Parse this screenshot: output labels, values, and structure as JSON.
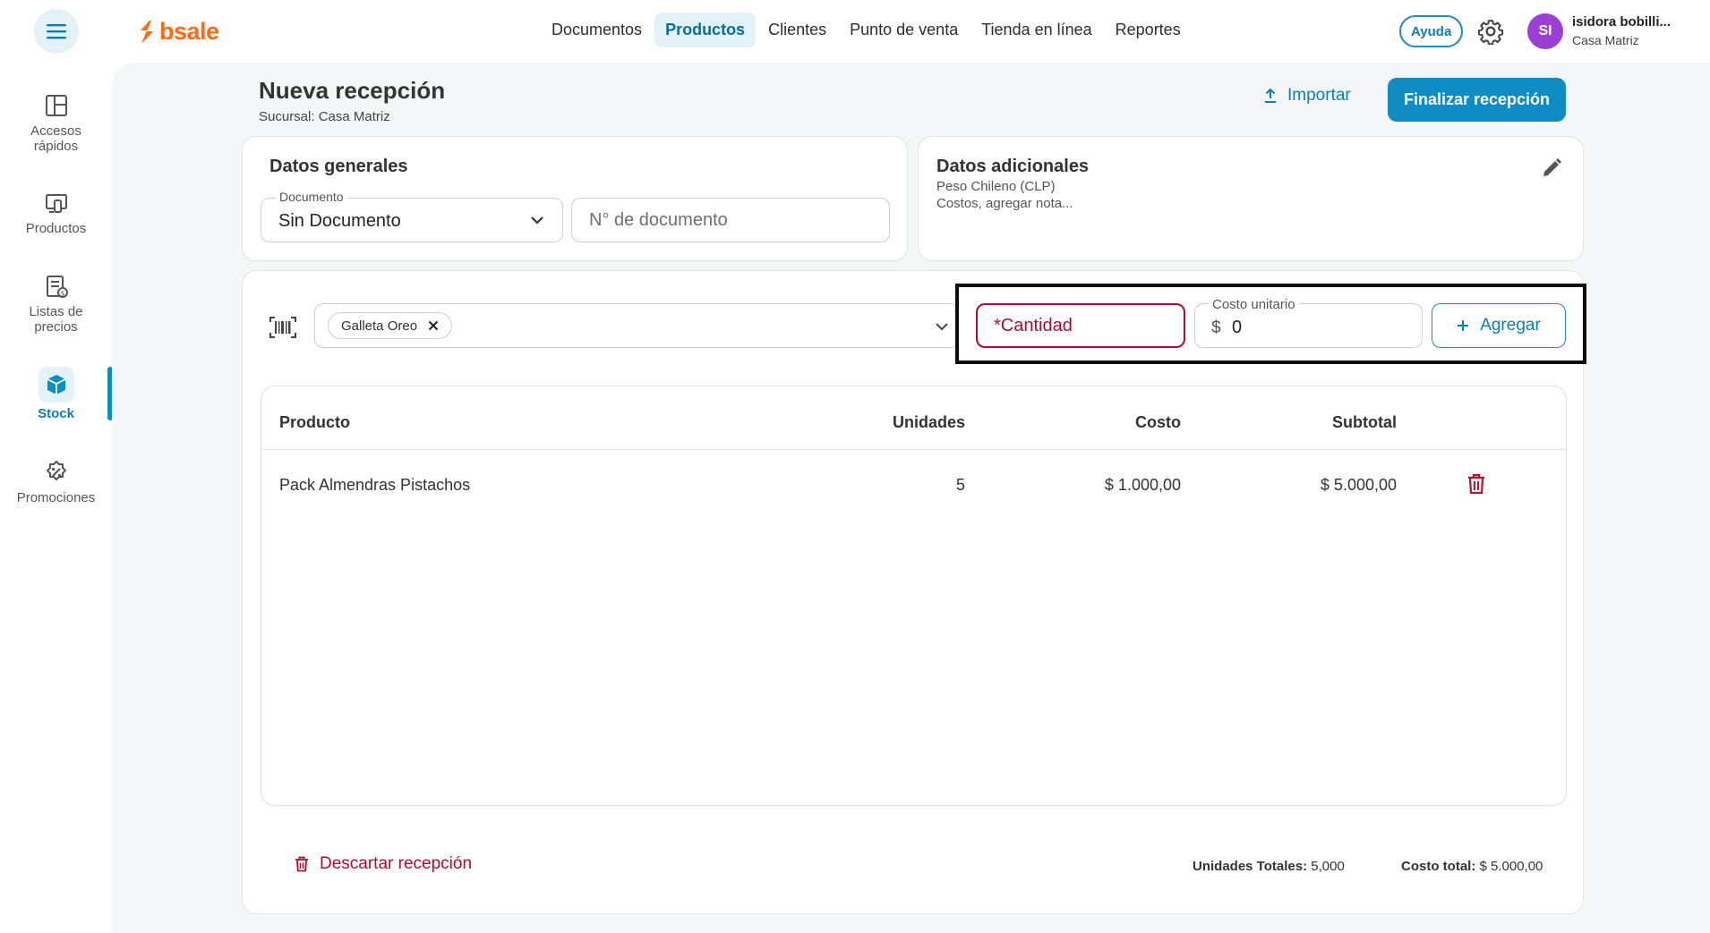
{
  "header": {
    "logo_text": "bsale",
    "nav": [
      {
        "label": "Documentos",
        "active": false
      },
      {
        "label": "Productos",
        "active": true
      },
      {
        "label": "Clientes",
        "active": false
      },
      {
        "label": "Punto de venta",
        "active": false
      },
      {
        "label": "Tienda en línea",
        "active": false
      },
      {
        "label": "Reportes",
        "active": false
      }
    ],
    "help_label": "Ayuda",
    "user": {
      "initials": "SI",
      "name": "isidora bobilli...",
      "branch": "Casa Matriz"
    }
  },
  "sidebar": {
    "items": [
      {
        "label": "Accesos rápidos",
        "icon": "layout-icon"
      },
      {
        "label": "Productos",
        "icon": "devices-icon"
      },
      {
        "label": "Listas de precios",
        "icon": "price-list-icon"
      },
      {
        "label": "Stock",
        "icon": "box-icon",
        "active": true
      },
      {
        "label": "Promociones",
        "icon": "discount-icon"
      }
    ]
  },
  "page": {
    "title": "Nueva recepción",
    "subtitle": "Sucursal: Casa Matriz",
    "import_label": "Importar",
    "finish_label": "Finalizar recepción"
  },
  "general": {
    "title": "Datos generales",
    "document_label": "Documento",
    "document_value": "Sin Documento",
    "doc_number_placeholder": "N° de documento"
  },
  "extra": {
    "title": "Datos adicionales",
    "currency": "Peso Chileno (CLP)",
    "note": "Costos, agregar nota..."
  },
  "add_row": {
    "selected_product": "Galleta Oreo",
    "quantity_placeholder": "*Cantidad",
    "unit_cost_label": "Costo unitario",
    "currency_symbol": "$",
    "unit_cost_value": "0",
    "add_label": "Agregar"
  },
  "table": {
    "columns": [
      "Producto",
      "Unidades",
      "Costo",
      "Subtotal"
    ],
    "rows": [
      {
        "product": "Pack Almendras Pistachos",
        "units": "5",
        "cost": "$ 1.000,00",
        "subtotal": "$ 5.000,00"
      }
    ]
  },
  "footer": {
    "discard_label": "Descartar recepción",
    "units_total_label": "Unidades Totales:",
    "units_total_value": "5,000",
    "cost_total_label": "Costo total:",
    "cost_total_value": "$ 5.000,00"
  },
  "colors": {
    "brand": "#ff6a13",
    "primary": "#108cc4",
    "danger": "#b00b2f",
    "avatar": "#9b3fd6"
  }
}
